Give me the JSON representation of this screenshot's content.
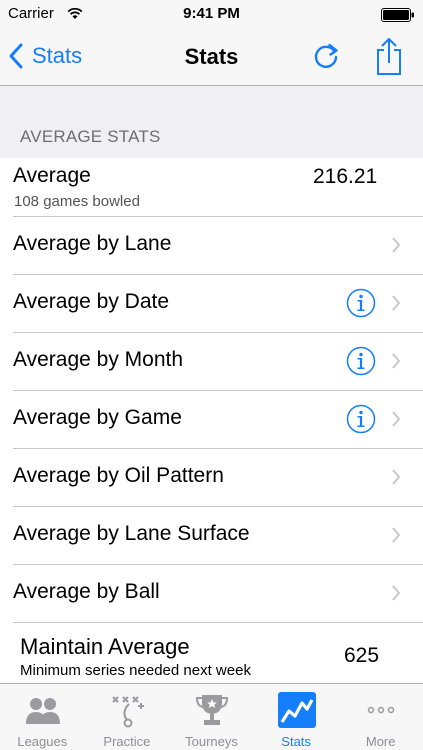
{
  "status_bar": {
    "carrier": "Carrier",
    "time": "9:41 PM"
  },
  "nav": {
    "back_label": "Stats",
    "title": "Stats"
  },
  "section": {
    "header": "AVERAGE STATS"
  },
  "average": {
    "title": "Average",
    "subtitle": "108 games bowled",
    "value": "216.21"
  },
  "rows": [
    {
      "label": "Average by Lane",
      "info": false
    },
    {
      "label": "Average by Date",
      "info": true
    },
    {
      "label": "Average by Month",
      "info": true
    },
    {
      "label": "Average by Game",
      "info": true
    },
    {
      "label": "Average by Oil Pattern",
      "info": false
    },
    {
      "label": "Average by Lane Surface",
      "info": false
    },
    {
      "label": "Average by Ball",
      "info": false
    }
  ],
  "maintain": {
    "title": "Maintain Average",
    "subtitle": "Minimum series needed next week",
    "value": "625"
  },
  "tabs": [
    {
      "label": "Leagues",
      "icon": "people-icon"
    },
    {
      "label": "Practice",
      "icon": "playbook-icon"
    },
    {
      "label": "Tourneys",
      "icon": "trophy-icon"
    },
    {
      "label": "Stats",
      "icon": "chart-icon",
      "active": true
    },
    {
      "label": "More",
      "icon": "more-icon"
    }
  ],
  "colors": {
    "accent": "#157efb",
    "background": "#efeff4",
    "separator": "#c8c7cc"
  }
}
